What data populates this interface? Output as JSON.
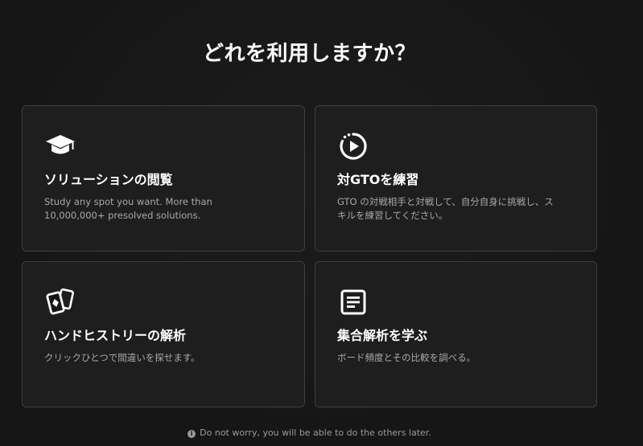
{
  "heading": "どれを利用しますか？",
  "cards": [
    {
      "icon": "graduation-cap-icon",
      "title": "ソリューションの閲覧",
      "description": "Study any spot you want. More than 10,000,000+ presolved solutions."
    },
    {
      "icon": "play-rotate-icon",
      "title": "対GTOを練習",
      "description": "GTO の対戦相手と対戦して、自分自身に挑戦し、スキルを練習してください。"
    },
    {
      "icon": "playing-cards-icon",
      "title": "ハンドヒストリーの解析",
      "description": "クリックひとつで間違いを探せます。"
    },
    {
      "icon": "document-list-icon",
      "title": "集合解析を学ぶ",
      "description": "ボード頻度とその比較を調べる。"
    }
  ],
  "footer": {
    "icon": "info-icon",
    "info_glyph": "i",
    "text": "Do not worry, you will be able to do the others later."
  }
}
